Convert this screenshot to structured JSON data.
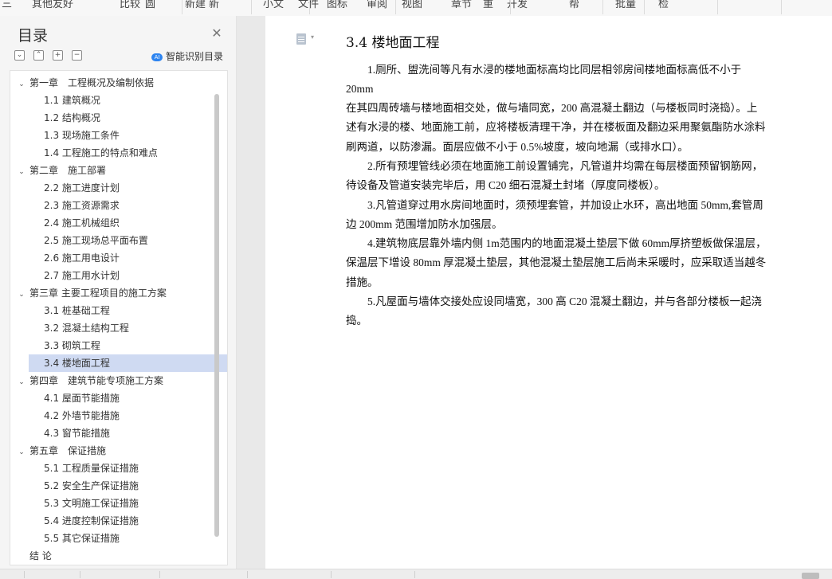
{
  "toolbar": {
    "items": [
      "三",
      "其他友好",
      "比较",
      "圆",
      "新建",
      "新",
      "小文",
      "文件",
      "图标",
      "审阅",
      "视图",
      "章节",
      "重",
      "开发",
      "帮",
      "批量",
      "检"
    ]
  },
  "sidebar": {
    "title": "目录",
    "smart_label": "智能识别目录",
    "smart_icon_text": "AI",
    "items": [
      {
        "label": "第一章　工程概况及编制依据",
        "level": 0
      },
      {
        "label": "1.1 建筑概况",
        "level": 1
      },
      {
        "label": "1.2 结构概况",
        "level": 1
      },
      {
        "label": "1.3 现场施工条件",
        "level": 1
      },
      {
        "label": "1.4 工程施工的特点和难点",
        "level": 1
      },
      {
        "label": "第二章　施工部署",
        "level": 0
      },
      {
        "label": "2.2 施工进度计划",
        "level": 1
      },
      {
        "label": "2.3 施工资源需求",
        "level": 1
      },
      {
        "label": "2.4 施工机械组织",
        "level": 1
      },
      {
        "label": "2.5 施工现场总平面布置",
        "level": 1
      },
      {
        "label": "2.6 施工用电设计",
        "level": 1
      },
      {
        "label": "2.7 施工用水计划",
        "level": 1
      },
      {
        "label": "第三章 主要工程项目的施工方案",
        "level": 0
      },
      {
        "label": "3.1 桩基础工程",
        "level": 1
      },
      {
        "label": "3.2 混凝土结构工程",
        "level": 1
      },
      {
        "label": "3.3 砌筑工程",
        "level": 1
      },
      {
        "label": "3.4 楼地面工程",
        "level": 1,
        "selected": true
      },
      {
        "label": "第四章　建筑节能专项施工方案",
        "level": 0
      },
      {
        "label": "4.1 屋面节能措施",
        "level": 1
      },
      {
        "label": "4.2 外墙节能措施",
        "level": 1
      },
      {
        "label": "4.3 窗节能措施",
        "level": 1
      },
      {
        "label": "第五章　保证措施",
        "level": 0
      },
      {
        "label": "5.1 工程质量保证措施",
        "level": 1
      },
      {
        "label": "5.2 安全生产保证措施",
        "level": 1
      },
      {
        "label": "5.3 文明施工保证措施",
        "level": 1
      },
      {
        "label": "5.4 进度控制保证措施",
        "level": 1
      },
      {
        "label": "5.5 其它保证措施",
        "level": 1
      },
      {
        "label": "结 论",
        "level": -1
      }
    ]
  },
  "document": {
    "heading": "3.4  楼地面工程",
    "paragraphs": [
      "　　1.厕所、盥洗间等凡有水浸的楼地面标高均比同层相邻房间楼地面标高低不小于 20mm",
      "在其四周砖墙与楼地面相交处，做与墙同宽，200 高混凝土翻边（与楼板同时浇捣）。上述有水浸的楼、地面施工前，应将楼板清理干净，并在楼板面及翻边采用聚氨酯防水涂料刷两道，以防渗漏。面层应做不小于 0.5%坡度，坡向地漏（或排水口）。",
      "　　2.所有预埋管线必须在地面施工前设置铺完，凡管道井均需在每层楼面预留钢筋网，待设备及管道安装完毕后，用 C20 细石混凝土封堵（厚度同楼板）。",
      "　　3.凡管道穿过用水房间地面时，须预埋套管，并加设止水环，高出地面 50mm,套管周边 200mm 范围增加防水加强层。",
      "　　4.建筑物底层靠外墙内侧 1m范围内的地面混凝土垫层下做 60mm厚挤塑板做保温层，保温层下增设 80mm 厚混凝土垫层，其他混凝土垫层施工后尚未采暖时，应采取适当越冬措施。",
      "　　5.凡屋面与墙体交接处应设同墙宽，300 高 C20 混凝土翻边，并与各部分楼板一起浇捣。"
    ]
  }
}
